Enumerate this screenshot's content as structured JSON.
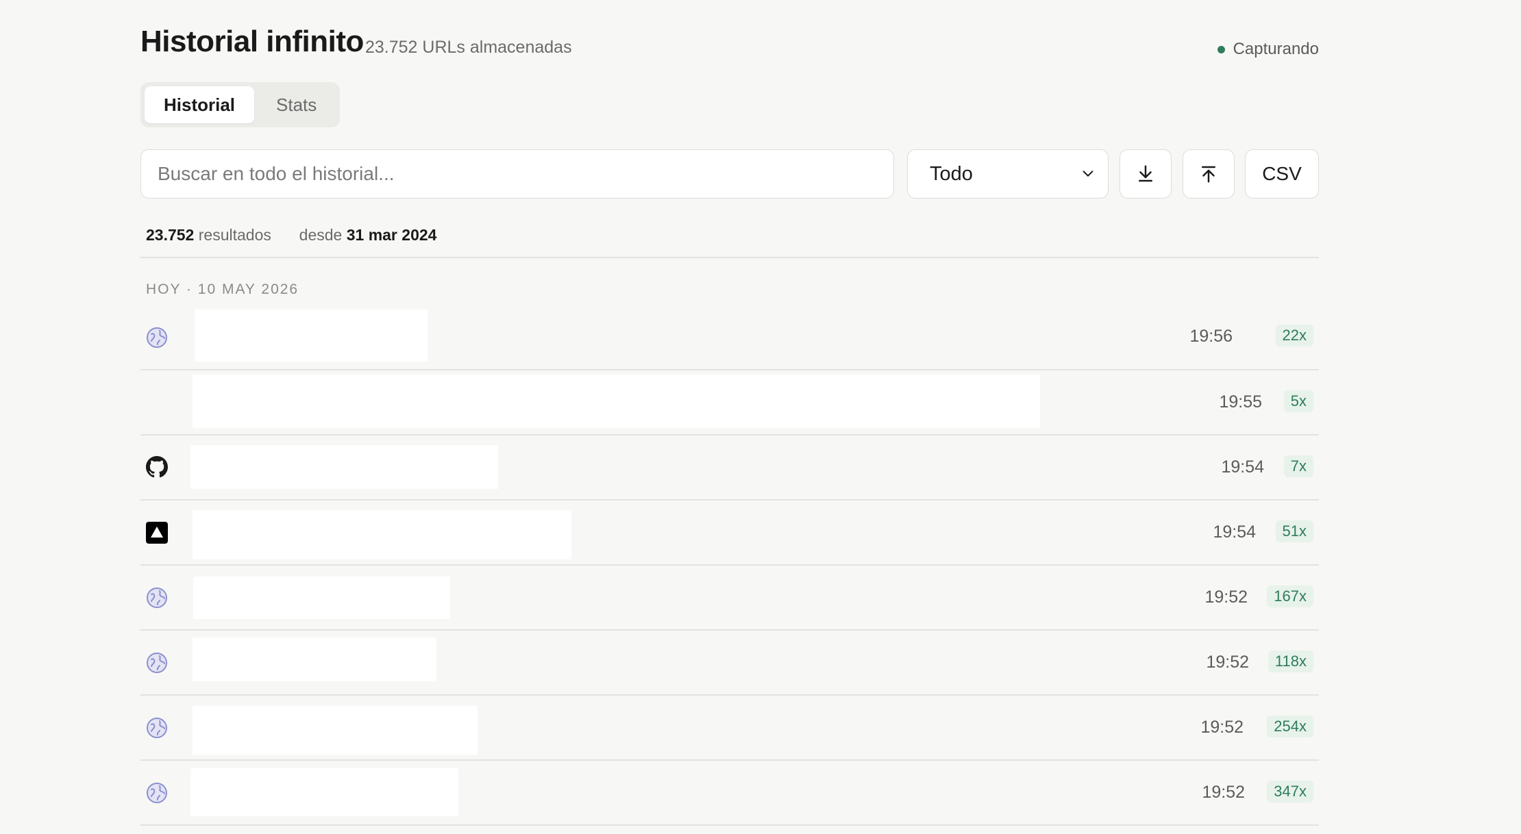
{
  "header": {
    "title": "Historial infinito",
    "subtitle": "23.752 URLs almacenadas",
    "status": "Capturando"
  },
  "tabs": [
    {
      "label": "Historial",
      "active": true
    },
    {
      "label": "Stats",
      "active": false
    }
  ],
  "toolbar": {
    "search_placeholder": "Buscar en todo el historial...",
    "search_value": "",
    "filter_selected": "Todo",
    "download_icon": "download-icon",
    "upload_icon": "upload-icon",
    "csv_label": "CSV"
  },
  "summary": {
    "count": "23.752",
    "count_suffix": "resultados",
    "since_prefix": "desde",
    "since_date": "31 mar 2024"
  },
  "day": {
    "label": "HOY · 10 MAY 2026"
  },
  "entries": [
    {
      "icon": "globe-icon",
      "time": "19:56",
      "visits": "22x"
    },
    {
      "icon": "",
      "time": "19:55",
      "visits": "5x"
    },
    {
      "icon": "github-icon",
      "time": "19:54",
      "visits": "7x"
    },
    {
      "icon": "triangle-logo-icon",
      "time": "19:54",
      "visits": "51x"
    },
    {
      "icon": "globe-icon",
      "time": "19:52",
      "visits": "167x"
    },
    {
      "icon": "globe-icon",
      "time": "19:52",
      "visits": "118x"
    },
    {
      "icon": "globe-icon",
      "time": "19:52",
      "visits": "254x"
    },
    {
      "icon": "globe-icon",
      "time": "19:52",
      "visits": "347x"
    }
  ],
  "colors": {
    "background": "#f7f7f5",
    "accent_green": "#2f7d5a",
    "badge_bg": "#e7f2eb"
  }
}
